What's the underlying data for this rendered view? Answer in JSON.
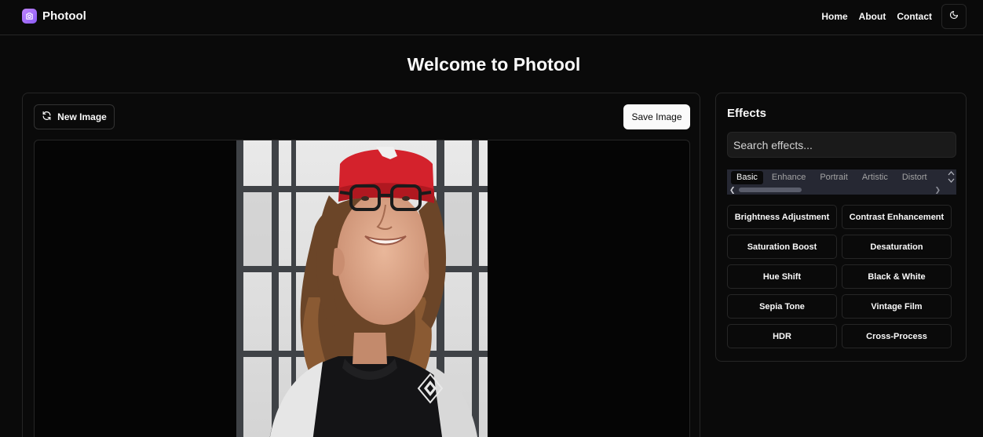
{
  "header": {
    "brand": "Photool",
    "nav": [
      "Home",
      "About",
      "Contact"
    ]
  },
  "page": {
    "title": "Welcome to Photool"
  },
  "editor": {
    "new_image_label": "New Image",
    "save_image_label": "Save Image"
  },
  "effects": {
    "title": "Effects",
    "search_placeholder": "Search effects...",
    "tabs": [
      "Basic",
      "Enhance",
      "Portrait",
      "Artistic",
      "Distort"
    ],
    "active_tab": "Basic",
    "items": [
      "Brightness Adjustment",
      "Contrast Enhancement",
      "Saturation Boost",
      "Desaturation",
      "Hue Shift",
      "Black & White",
      "Sepia Tone",
      "Vintage Film",
      "HDR",
      "Cross-Process"
    ]
  },
  "colors": {
    "background": "#0a0a0a",
    "border": "#262626",
    "accent": "#a855f7",
    "primary_button": "#fafafa"
  },
  "icons": {
    "brand": "camera-icon",
    "theme": "moon-icon",
    "new_image": "refresh-icon"
  }
}
